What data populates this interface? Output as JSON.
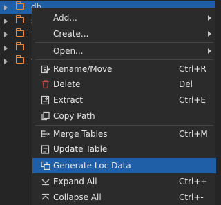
{
  "tree": {
    "rows": [
      {
        "label": "db",
        "selected": true
      },
      {
        "label": "s",
        "selected": false
      },
      {
        "label": "t",
        "selected": false
      },
      {
        "label": "u",
        "selected": false
      },
      {
        "label": "v",
        "selected": false
      }
    ]
  },
  "menu": {
    "add": {
      "label": "Add..."
    },
    "create": {
      "label": "Create..."
    },
    "open": {
      "label": "Open..."
    },
    "rename": {
      "label": "Rename/Move",
      "shortcut": "Ctrl+R",
      "icon": "rename-icon"
    },
    "delete": {
      "label": "Delete",
      "shortcut": "Del",
      "icon": "trash-icon"
    },
    "extract": {
      "label": "Extract",
      "shortcut": "Ctrl+E",
      "icon": "extract-icon"
    },
    "copy_path": {
      "label": "Copy Path",
      "icon": "copy-icon"
    },
    "merge_tables": {
      "label": "Merge Tables",
      "shortcut": "Ctrl+M",
      "icon": "merge-icon"
    },
    "update_table": {
      "label": "Update Table",
      "icon": "update-icon"
    },
    "generate_loc": {
      "label": "Generate Loc Data",
      "icon": "generate-icon",
      "highlighted": true
    },
    "expand_all": {
      "label": "Expand All",
      "shortcut": "Ctrl++",
      "icon": "expand-icon"
    },
    "collapse_all": {
      "label": "Collapse All",
      "shortcut": "Ctrl+-",
      "icon": "collapse-icon"
    }
  },
  "colors": {
    "background": "#252526",
    "menu_background": "#2b2b2b",
    "highlight": "#1f5fa8",
    "folder": "#e8883a",
    "delete_icon": "#d84a4a"
  }
}
